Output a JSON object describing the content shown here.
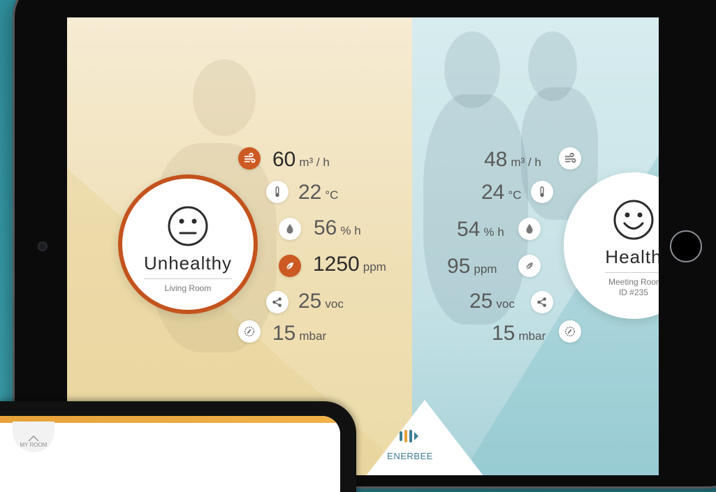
{
  "living_room": {
    "status": "Unhealthy",
    "room": "Living Room",
    "metrics": {
      "airflow": {
        "value": "60",
        "unit": "m³ / h"
      },
      "temperature": {
        "value": "22",
        "unit": "°C"
      },
      "humidity": {
        "value": "56",
        "unit": "% h"
      },
      "co2": {
        "value": "1250",
        "unit": "ppm"
      },
      "voc": {
        "value": "25",
        "unit": "voc"
      },
      "pressure": {
        "value": "15",
        "unit": "mbar"
      }
    }
  },
  "meeting_room": {
    "status": "Health",
    "room": "Meeting Roor",
    "room_id": "ID #235",
    "metrics": {
      "airflow": {
        "value": "48",
        "unit": "m³ / h"
      },
      "temperature": {
        "value": "24",
        "unit": "°C"
      },
      "humidity": {
        "value": "54",
        "unit": "% h"
      },
      "co2": {
        "value": "95",
        "unit": "ppm"
      },
      "voc": {
        "value": "25",
        "unit": "voc"
      },
      "pressure": {
        "value": "15",
        "unit": "mbar"
      }
    }
  },
  "brand": {
    "name": "ENERBEE"
  },
  "phone": {
    "my_room_label": "MY ROOM"
  },
  "colors": {
    "alert": "#cc5a22",
    "brand": "#3b7f94",
    "phone_accent": "#e8a13a"
  },
  "icons": [
    "airflow-icon",
    "thermometer-icon",
    "humidity-drop-icon",
    "leaf-co2-icon",
    "voc-share-icon",
    "pressure-gauge-icon",
    "neutral-face-icon",
    "happy-face-icon",
    "enerbee-logo-icon",
    "chevron-up-icon"
  ]
}
